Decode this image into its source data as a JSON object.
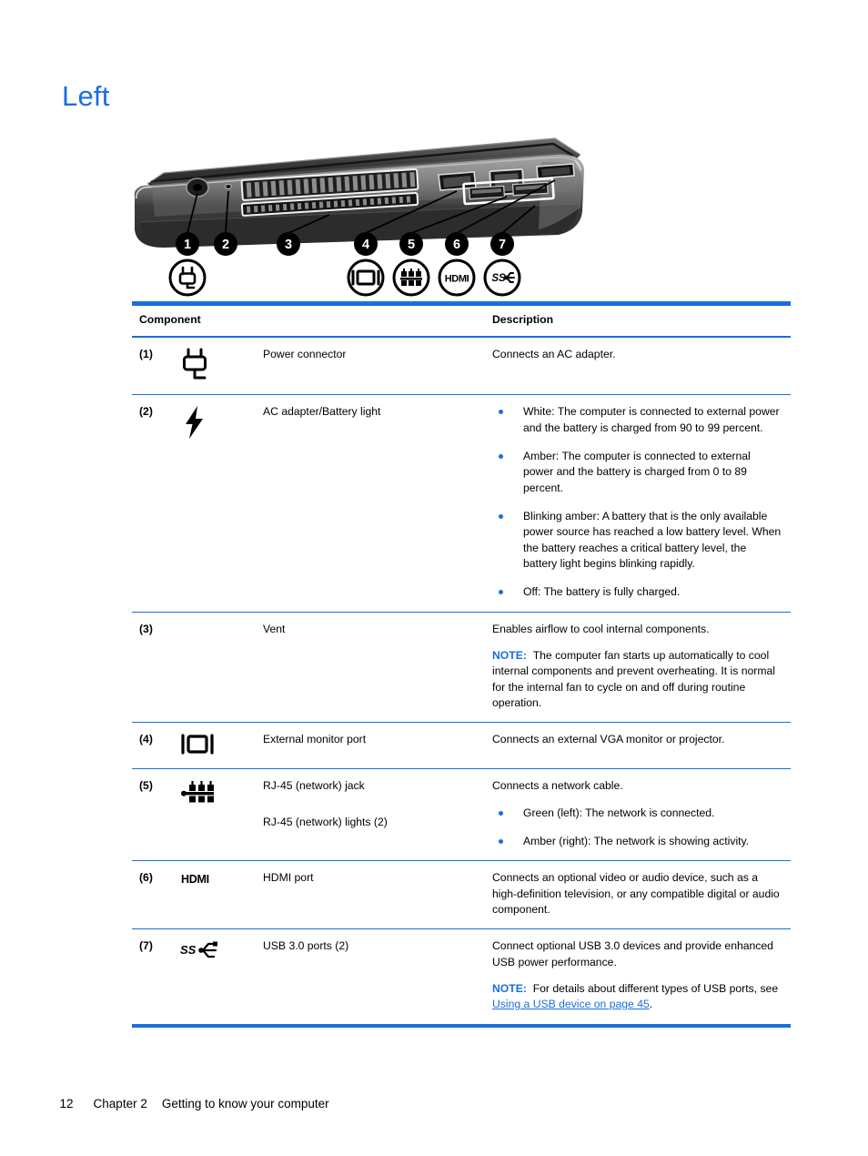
{
  "page": {
    "title": "Left",
    "footer": {
      "page_number": "12",
      "chapter": "Chapter 2",
      "chapter_title": "Getting to know your computer"
    }
  },
  "figure": {
    "alt": "Left side view of laptop showing ports",
    "callouts": [
      "1",
      "2",
      "3",
      "4",
      "5",
      "6",
      "7"
    ],
    "legend_icons": [
      {
        "number": "1",
        "icon": "power-connector-icon"
      },
      {
        "number": "2",
        "icon": "none"
      },
      {
        "number": "3",
        "icon": "none"
      },
      {
        "number": "4",
        "icon": "external-monitor-icon"
      },
      {
        "number": "5",
        "icon": "rj45-network-icon"
      },
      {
        "number": "6",
        "icon": "hdmi-icon"
      },
      {
        "number": "7",
        "icon": "usb-superspeed-icon"
      }
    ]
  },
  "table": {
    "headers": {
      "component": "Component",
      "description": "Description"
    },
    "rows": [
      {
        "num": "(1)",
        "icon": "power-connector-icon",
        "names": [
          "Power connector"
        ],
        "desc_paragraphs": [
          "Connects an AC adapter."
        ],
        "bullets": [],
        "note": null
      },
      {
        "num": "(2)",
        "icon": "battery-light-icon",
        "names": [
          "AC adapter/Battery light"
        ],
        "desc_paragraphs": [],
        "bullets": [
          "White: The computer is connected to external power and the battery is charged from 90 to 99 percent.",
          "Amber: The computer is connected to external power and the battery is charged from 0 to 89 percent.",
          "Blinking amber: A battery that is the only available power source has reached a low battery level. When the battery reaches a critical battery level, the battery light begins blinking rapidly.",
          "Off: The battery is fully charged."
        ],
        "note": null
      },
      {
        "num": "(3)",
        "icon": "none",
        "names": [
          "Vent"
        ],
        "desc_paragraphs": [
          "Enables airflow to cool internal components."
        ],
        "bullets": [],
        "note": {
          "label": "NOTE:",
          "text": "The computer fan starts up automatically to cool internal components and prevent overheating. It is normal for the internal fan to cycle on and off during routine operation."
        }
      },
      {
        "num": "(4)",
        "icon": "external-monitor-icon",
        "names": [
          "External monitor port"
        ],
        "desc_paragraphs": [
          "Connects an external VGA monitor or projector."
        ],
        "bullets": [],
        "note": null
      },
      {
        "num": "(5)",
        "icon": "rj45-network-icon",
        "names": [
          "RJ-45 (network) jack",
          "RJ-45 (network) lights (2)"
        ],
        "desc_paragraphs": [
          "Connects a network cable."
        ],
        "bullets": [
          "Green (left): The network is connected.",
          "Amber (right): The network is showing activity."
        ],
        "note": null
      },
      {
        "num": "(6)",
        "icon": "hdmi-icon",
        "names": [
          "HDMI port"
        ],
        "desc_paragraphs": [
          "Connects an optional video or audio device, such as a high-definition television, or any compatible digital or audio component."
        ],
        "bullets": [],
        "note": null
      },
      {
        "num": "(7)",
        "icon": "usb-superspeed-icon",
        "names": [
          "USB 3.0 ports (2)"
        ],
        "desc_paragraphs": [
          "Connect optional USB 3.0 devices and provide enhanced USB power performance."
        ],
        "bullets": [],
        "note": {
          "label": "NOTE:",
          "text_before": "For details about different types of USB ports, see ",
          "link": "Using a USB device on page 45",
          "text_after": "."
        }
      }
    ]
  },
  "colors": {
    "accent_blue": "#1a6fe0",
    "text": "#000000",
    "background": "#ffffff"
  }
}
